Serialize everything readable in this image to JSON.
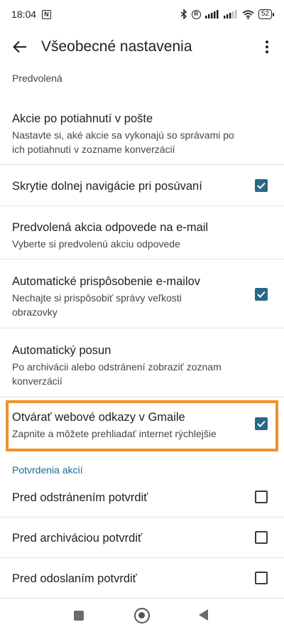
{
  "status_bar": {
    "time": "18:04",
    "nfc": "N",
    "r_badge": "R",
    "battery": "52"
  },
  "app_bar": {
    "title": "Všeobecné nastavenia"
  },
  "sections": {
    "default_label": "Predvolená",
    "confirm_label": "Potvrdenia akcií"
  },
  "rows": [
    {
      "title": "Akcie po potiahnutí v pošte",
      "subtitle": "Nastavte si, aké akcie sa vykonajú so správami po ich potiahnutí v zozname konverzácií",
      "checkbox": null
    },
    {
      "title": "Skrytie dolnej navigácie pri posúvaní",
      "subtitle": "",
      "checkbox": true
    },
    {
      "title": "Predvolená akcia odpovede na e-mail",
      "subtitle": "Vyberte si predvolenú akciu odpovede",
      "checkbox": null
    },
    {
      "title": "Automatické prispôsobenie e-mailov",
      "subtitle": "Nechajte si prispôsobiť správy veľkosti obrazovky",
      "checkbox": true
    },
    {
      "title": "Automatický posun",
      "subtitle": "Po archivácii alebo odstránení zobraziť zoznam konverzácií",
      "checkbox": null
    },
    {
      "title": "Otvárať webové odkazy v Gmaile",
      "subtitle": "Zapnite a môžete prehliadať internet rýchlejšie",
      "checkbox": true
    },
    {
      "title": "Pred odstránením potvrdiť",
      "subtitle": "",
      "checkbox": false
    },
    {
      "title": "Pred archiváciou potvrdiť",
      "subtitle": "",
      "checkbox": false
    },
    {
      "title": "Pred odoslaním potvrdiť",
      "subtitle": "",
      "checkbox": false
    }
  ],
  "colors": {
    "accent": "#1a6b94",
    "checkbox": "#2b6788",
    "highlight": "#f0922b"
  },
  "icons": {
    "back": "arrow-back-icon",
    "more": "more-vert-icon"
  }
}
